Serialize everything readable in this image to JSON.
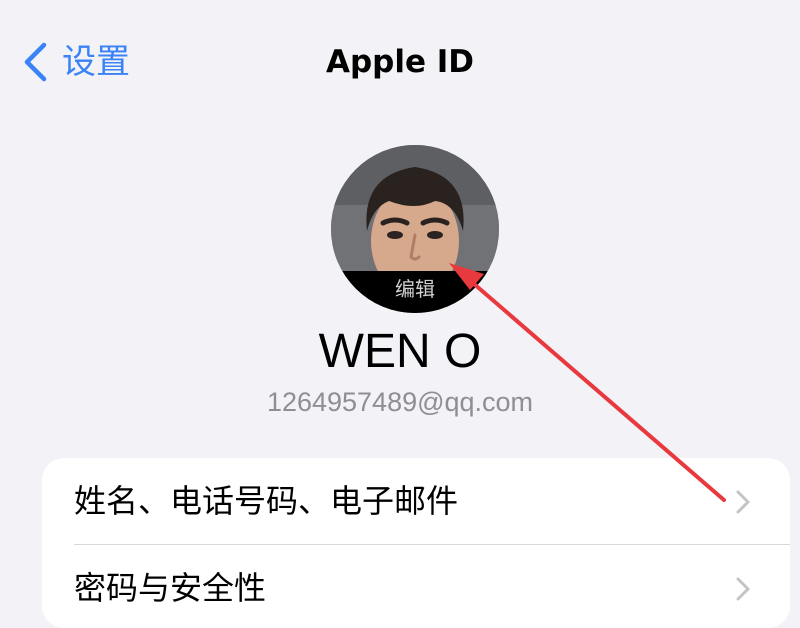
{
  "nav": {
    "back_label": "设置",
    "title": "Apple ID"
  },
  "profile": {
    "edit_label": "编辑",
    "name": "WEN O",
    "email": "1264957489@qq.com"
  },
  "menu": {
    "items": [
      {
        "label": "姓名、电话号码、电子邮件"
      },
      {
        "label": "密码与安全性"
      }
    ]
  },
  "colors": {
    "accent": "#3a82f7",
    "background": "#f2f2f7",
    "annotation_arrow": "#e8393f"
  },
  "icons": [
    "chevron-left-icon",
    "chevron-right-icon",
    "annotation-arrow"
  ]
}
